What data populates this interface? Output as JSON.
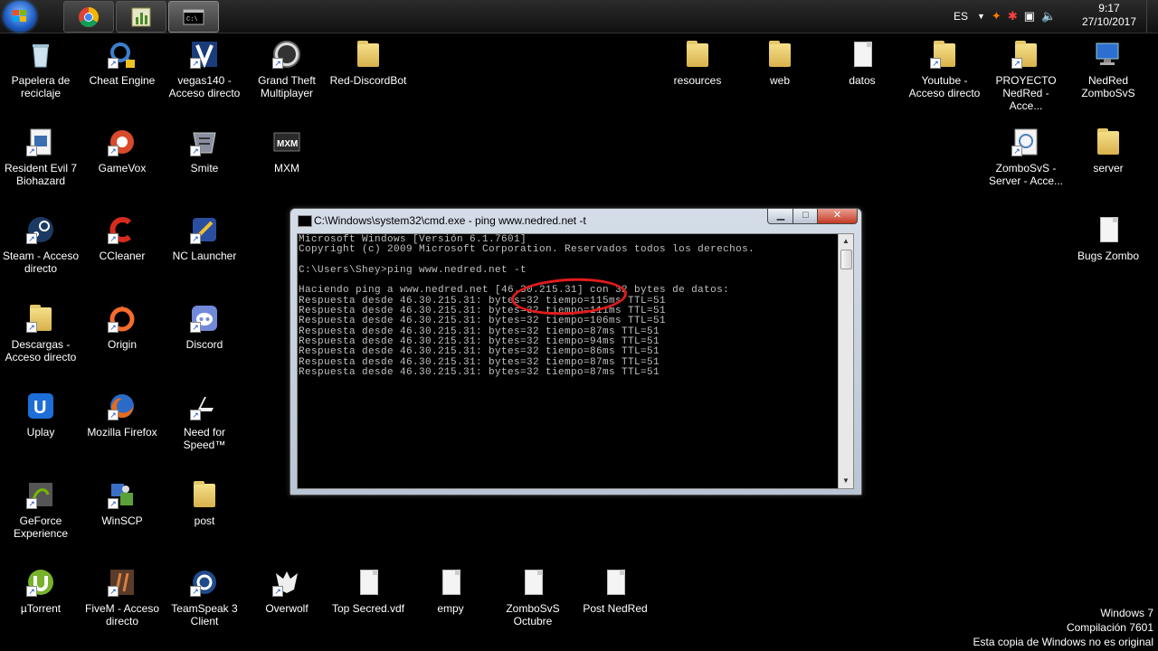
{
  "taskbar": {
    "lang": "ES",
    "clock_time": "9:17",
    "clock_date": "27/10/2017"
  },
  "desktop_icons_left": [
    {
      "label": "Papelera de\nreciclaje",
      "icon": "recycle-bin-icon"
    },
    {
      "label": "Cheat Engine",
      "icon": "cheat-engine-icon"
    },
    {
      "label": "vegas140 -\nAcceso directo",
      "icon": "vegas-icon"
    },
    {
      "label": "Grand Theft\nMultiplayer",
      "icon": "gtmp-icon"
    },
    {
      "label": "Red-DiscordBot",
      "icon": "folder-icon"
    }
  ],
  "desktop_icons": {
    "recycle": "Papelera de reciclaje",
    "cheat": "Cheat Engine",
    "vegas": "vegas140 - Acceso directo",
    "gtmp": "Grand Theft Multiplayer",
    "reddiscord": "Red-DiscordBot",
    "resources": "resources",
    "web": "web",
    "datos": "datos",
    "youtube": "Youtube - Acceso directo",
    "proyecto": "PROYECTO NedRed - Acce...",
    "nedred_zombo": "NedRed ZomboSvS",
    "re7": "Resident Evil 7 Biohazard",
    "gamevox": "GameVox",
    "smite": "Smite",
    "mxm": "MXM",
    "zombo_server": "ZomboSvS - Server - Acce...",
    "server": "server",
    "steam": "Steam - Acceso directo",
    "ccleaner": "CCleaner",
    "nclauncher": "NC Launcher",
    "bugs": "Bugs Zombo",
    "descargas": "Descargas - Acceso directo",
    "origin": "Origin",
    "discord": "Discord",
    "uplay": "Uplay",
    "firefox": "Mozilla Firefox",
    "nfs": "Need for Speed™",
    "geforce": "GeForce Experience",
    "winscp": "WinSCP",
    "post": "post",
    "utorrent": "µTorrent",
    "fivem": "FiveM - Acceso directo",
    "teamspeak": "TeamSpeak 3 Client",
    "overwolf": "Overwolf",
    "topsecred": "Top Secred.vdf",
    "empy": "empy",
    "zombo_octubre": "ZomboSvS Octubre",
    "post_nedred": "Post NedRed"
  },
  "cmd": {
    "title": "C:\\Windows\\system32\\cmd.exe - ping  www.nedred.net -t",
    "lines": [
      "Microsoft Windows [Versión 6.1.7601]",
      "Copyright (c) 2009 Microsoft Corporation. Reservados todos los derechos.",
      "",
      "C:\\Users\\Shey>ping www.nedred.net -t",
      "",
      "Haciendo ping a www.nedred.net [46.30.215.31] con 32 bytes de datos:",
      "Respuesta desde 46.30.215.31: bytes=32 tiempo=115ms TTL=51",
      "Respuesta desde 46.30.215.31: bytes=32 tiempo=111ms TTL=51",
      "Respuesta desde 46.30.215.31: bytes=32 tiempo=106ms TTL=51",
      "Respuesta desde 46.30.215.31: bytes=32 tiempo=87ms TTL=51",
      "Respuesta desde 46.30.215.31: bytes=32 tiempo=94ms TTL=51",
      "Respuesta desde 46.30.215.31: bytes=32 tiempo=86ms TTL=51",
      "Respuesta desde 46.30.215.31: bytes=32 tiempo=87ms TTL=51",
      "Respuesta desde 46.30.215.31: bytes=32 tiempo=87ms TTL=51"
    ]
  },
  "watermark": {
    "line1": "Windows 7",
    "line2": "Compilación  7601",
    "line3": "Esta copia de Windows no es original"
  },
  "colors": {
    "desktop_bg": "#000000",
    "annotation_circle": "#e21b1b"
  }
}
